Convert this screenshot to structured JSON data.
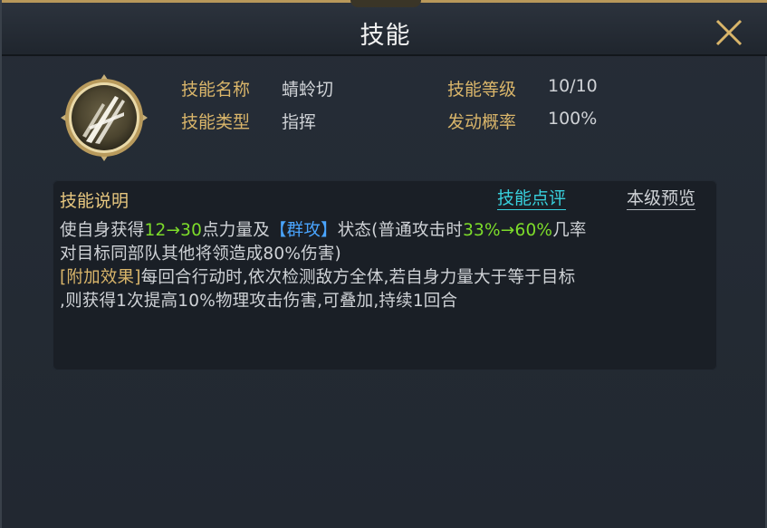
{
  "window": {
    "title": "技能",
    "close_icon": "close-x-icon"
  },
  "skill": {
    "icon": "skill-slash-icon",
    "name_label": "技能名称",
    "name_value": "蜻蛉切",
    "type_label": "技能类型",
    "type_value": "指挥",
    "level_label": "技能等级",
    "level_value": "10/10",
    "rate_label": "发动概率",
    "rate_value": "100%"
  },
  "description": {
    "title": "技能说明",
    "review_link": "技能点评",
    "preview_link": "本级预览",
    "line1": {
      "p1": "使自身获得",
      "power_range": "12→30",
      "p2": "点力量及",
      "status": "【群攻】",
      "p3": "状态(普通攻击时",
      "chance_range": "33%→60%",
      "p4": "几率"
    },
    "line2": "对目标同部队其他将领造成80%伤害)",
    "line3": {
      "tag": "[附加效果]",
      "text": "每回合行动时,依次检测敌方全体,若自身力量大于等于目标"
    },
    "line4": ",则获得1次提高10%物理攻击伤害,可叠加,持续1回合"
  },
  "colors": {
    "gold": "#d9b56a",
    "green": "#7ddc2a",
    "blue": "#4aa5ff",
    "cyan": "#38d0dd"
  }
}
